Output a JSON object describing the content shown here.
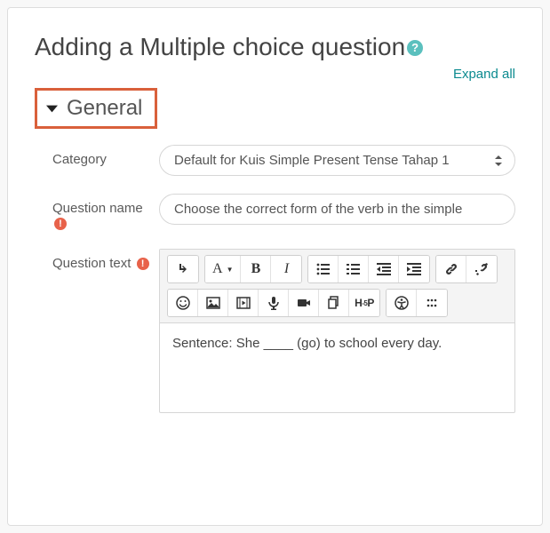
{
  "page": {
    "title": "Adding a Multiple choice question",
    "expand_all": "Expand all"
  },
  "section": {
    "general": "General"
  },
  "labels": {
    "category": "Category",
    "question_name": "Question name",
    "question_text": "Question text"
  },
  "category": {
    "selected": "Default for Kuis Simple Present Tense Tahap 1"
  },
  "question_name": {
    "value": "Choose the correct form of the verb in the simple"
  },
  "question_text": {
    "value": "Sentence: She ____ (go) to school every day."
  },
  "toolbar": {
    "font_letter": "A",
    "bold": "B",
    "italic": "I",
    "h5p": "H·P"
  }
}
